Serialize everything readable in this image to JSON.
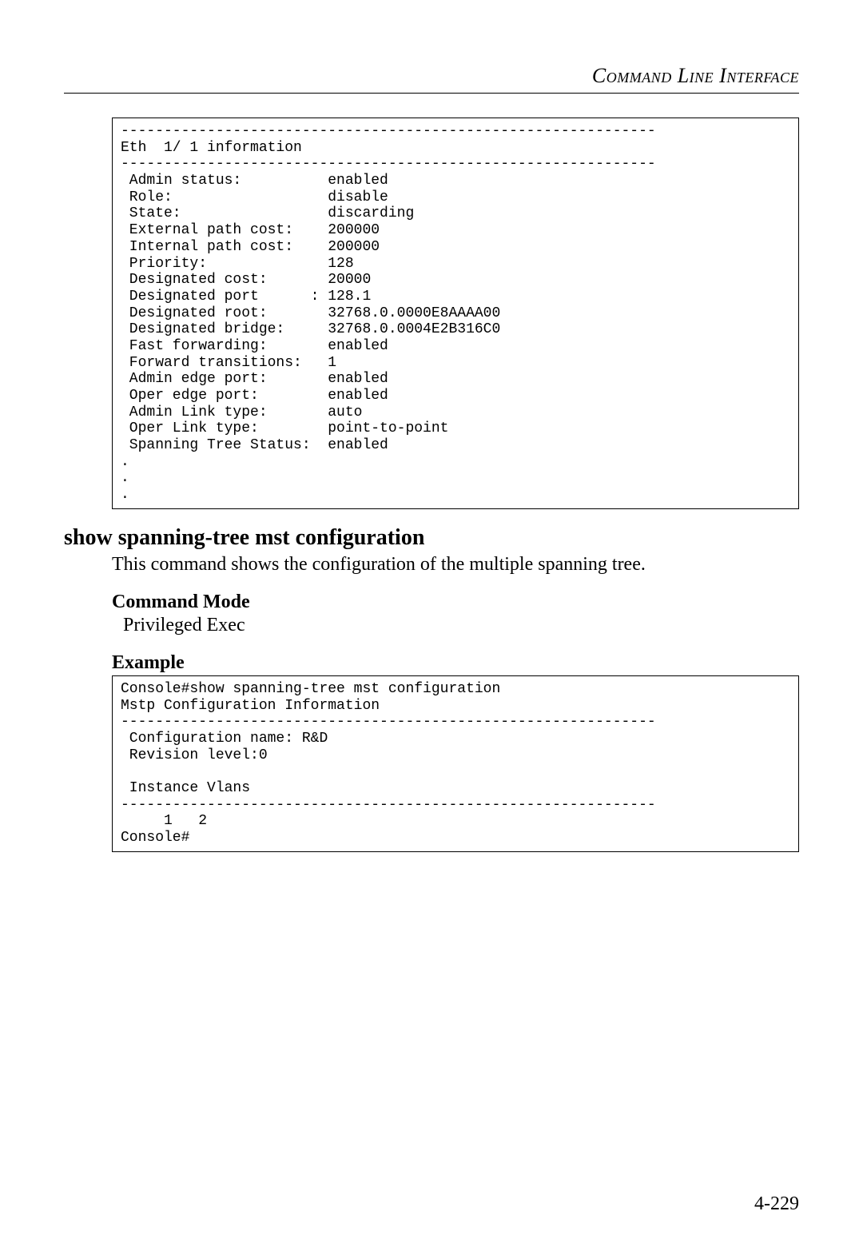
{
  "header": "Command Line Interface",
  "cli_output_1": "--------------------------------------------------------------\nEth  1/ 1 information\n--------------------------------------------------------------\n Admin status:          enabled\n Role:                  disable\n State:                 discarding\n External path cost:    200000\n Internal path cost:    200000\n Priority:              128\n Designated cost:       20000\n Designated port      : 128.1\n Designated root:       32768.0.0000E8AAAA00\n Designated bridge:     32768.0.0004E2B316C0\n Fast forwarding:       enabled\n Forward transitions:   1\n Admin edge port:       enabled\n Oper edge port:        enabled\n Admin Link type:       auto\n Oper Link type:        point-to-point\n Spanning Tree Status:  enabled\n.\n.\n.",
  "section_title": "show spanning-tree mst configuration",
  "section_desc": "This command shows the configuration of the multiple spanning tree.",
  "command_mode_heading": "Command Mode",
  "command_mode_value": "Privileged Exec",
  "example_heading": "Example",
  "cli_output_2": "Console#show spanning-tree mst configuration\nMstp Configuration Information\n--------------------------------------------------------------\n Configuration name: R&D\n Revision level:0\n\n Instance Vlans\n--------------------------------------------------------------\n     1   2\nConsole#",
  "page_number": "4-229"
}
